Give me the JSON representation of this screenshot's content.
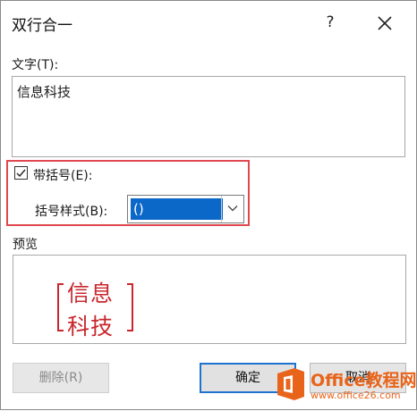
{
  "dialog": {
    "title": "双行合一",
    "help_label": "?"
  },
  "text_section": {
    "label": "文字(T):",
    "value": "信息科技"
  },
  "bracket_section": {
    "checkbox_label": "带括号(E):",
    "checked": true,
    "style_label": "括号样式(B):",
    "style_value": "()"
  },
  "preview": {
    "label": "预览",
    "line1": "信息",
    "line2": "科技"
  },
  "buttons": {
    "delete_label": "删除(R)",
    "ok_label": "确定",
    "cancel_label": "取消"
  },
  "watermark": {
    "brand": "Office教程网",
    "url": "www.office26.com"
  },
  "colors": {
    "highlight_border": "#e0474f",
    "selection": "#0b67c8",
    "preview_text": "#c8282e",
    "watermark_orange": "#e8641b"
  }
}
